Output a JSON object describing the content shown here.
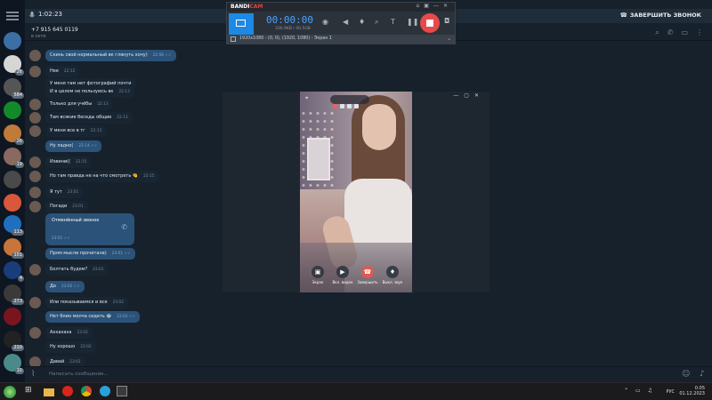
{
  "call_bar": {
    "timer": "1:02:23",
    "end_call_label": "ЗАВЕРШИТЬ ЗВОНОК"
  },
  "header": {
    "contact": "+7 915 645 0119",
    "status": "в сети"
  },
  "sidebar": {
    "badges": [
      "",
      "26",
      "584",
      "",
      "26",
      "19",
      "",
      "",
      "113",
      "101",
      "4",
      "273",
      "",
      "210",
      "10"
    ]
  },
  "messages": [
    {
      "text": "Скинь свой нормальный вк глянуть хочу)",
      "time": "22:08",
      "dir": "out",
      "check": "✓✓"
    },
    {
      "text": "Нее",
      "time": "22:12",
      "dir": "in"
    },
    {
      "text": "У меня там нет фотографий почти",
      "time": "",
      "dir": "in"
    },
    {
      "text": "И в целом не пользуюсь вк",
      "time": "22:13",
      "dir": "in"
    },
    {
      "text": "Только для учёбы",
      "time": "22:13",
      "dir": "in"
    },
    {
      "text": "Там всякие беседы общие",
      "time": "22:13",
      "dir": "in"
    },
    {
      "text": "У меня все в тг",
      "time": "22:13",
      "dir": "in"
    },
    {
      "text": "Ну ладно(",
      "time": "22:14",
      "dir": "out",
      "check": "✓✓"
    },
    {
      "text": "Извини((",
      "time": "22:15",
      "dir": "in"
    },
    {
      "text": "Но там правда не на что смотреть",
      "time": "22:15",
      "dir": "in",
      "emoji": "🤏"
    },
    {
      "text": "Я тут",
      "time": "23:01",
      "dir": "in"
    },
    {
      "text": "Погади",
      "time": "23:01",
      "dir": "in"
    },
    {
      "text": "Прям мысли прочитала)",
      "time": "23:01",
      "dir": "out",
      "check": "✓✓"
    },
    {
      "text": "Болтать будем?",
      "time": "23:01",
      "dir": "in"
    },
    {
      "text": "Да",
      "time": "23:02",
      "dir": "out",
      "check": "✓✓"
    },
    {
      "text": "Или показываемся и все",
      "time": "23:02",
      "dir": "in"
    },
    {
      "text": "Нет блин молча сидеть",
      "time": "23:02",
      "dir": "out",
      "check": "✓✓",
      "emoji": "😂"
    },
    {
      "text": "Аххахаха",
      "time": "23:02",
      "dir": "in"
    },
    {
      "text": "Ну хорошо",
      "time": "23:02",
      "dir": "in"
    },
    {
      "text": "Давай",
      "time": "23:02",
      "dir": "in"
    }
  ],
  "missed_call": {
    "label": "Отменённый звонок",
    "time": "23:01"
  },
  "composer": {
    "placeholder": "Написать сообщение..."
  },
  "bandicam": {
    "logo_a": "BANDI",
    "logo_b": "CAM",
    "timer": "00:00:00",
    "size": "336.9KB / 40.5GB",
    "area_info": "1920x1080 - (0, 0), (1920, 1080) - Экран 1"
  },
  "call_window": {
    "buttons": [
      {
        "label": "Экран",
        "icon": "screen-share-icon"
      },
      {
        "label": "Вкл. видео",
        "icon": "video-icon"
      },
      {
        "label": "Завершить",
        "icon": "hangup-icon"
      },
      {
        "label": "Выкл. звук",
        "icon": "mic-icon"
      }
    ]
  },
  "taskbar": {
    "lang": "РУС",
    "time": "0:05",
    "date": "01.12.2023"
  }
}
